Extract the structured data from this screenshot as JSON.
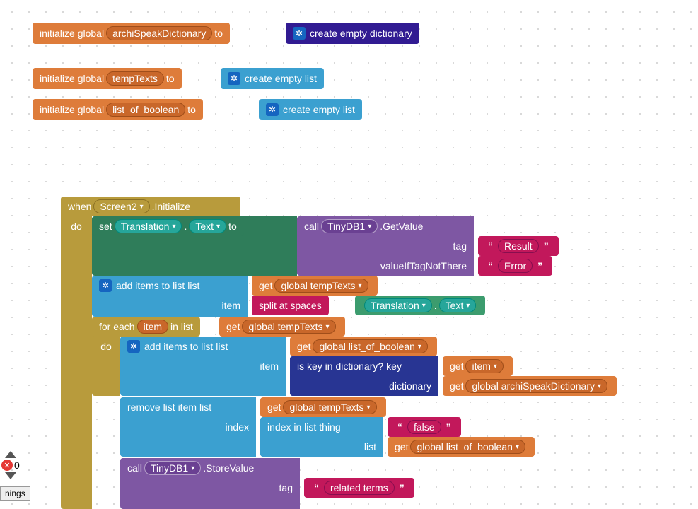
{
  "globals": {
    "init": "initialize global",
    "to": "to",
    "g1": "archiSpeakDictionary",
    "g2": "tempTexts",
    "g3": "list_of_boolean",
    "dict": "create empty dictionary",
    "list": "create empty list"
  },
  "event": {
    "when": "when",
    "screen": "Screen2",
    "init": ".Initialize",
    "do": "do"
  },
  "set": {
    "set": "set",
    "comp": "Translation",
    "dot": ".",
    "prop": "Text",
    "to": "to"
  },
  "call1": {
    "call": "call",
    "comp": "TinyDB1",
    "method": ".GetValue",
    "p1": "tag",
    "p2": "valueIfTagNotThere",
    "v1": "Result",
    "v2": "Error"
  },
  "add1": {
    "label": "add items to list",
    "p1": "list",
    "p2": "item"
  },
  "get": "get",
  "gTemp": "global tempTexts",
  "gBool": "global list_of_boolean",
  "gDict": "global archiSpeakDictionary",
  "split": "split at spaces",
  "transl": {
    "comp": "Translation",
    "prop": "Text"
  },
  "foreach": {
    "label": "for each",
    "item": "item",
    "in": "in list",
    "do": "do"
  },
  "isKey": {
    "l1": "is key in dictionary?",
    "k": "key",
    "d": "dictionary"
  },
  "itemVar": "item",
  "remove": {
    "label": "remove list item",
    "p1": "list",
    "p2": "index"
  },
  "idx": {
    "label": "index in list",
    "thing": "thing",
    "list": "list"
  },
  "false": "false",
  "call2": {
    "call": "call",
    "comp": "TinyDB1",
    "method": ".StoreValue",
    "p1": "tag",
    "v1": "related terms"
  },
  "ui": {
    "err": "0",
    "tab": "nings"
  }
}
